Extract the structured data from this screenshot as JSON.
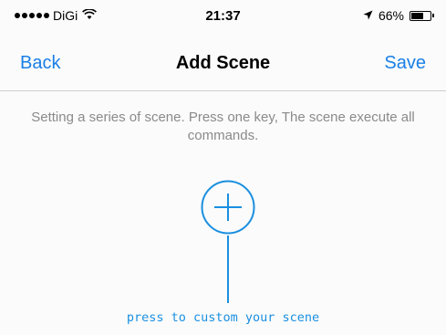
{
  "status_bar": {
    "carrier": "DiGi",
    "time": "21:37",
    "battery": "66%",
    "battery_level": 0.66,
    "icons": [
      "signal-dots-icon",
      "wifi-icon",
      "location-arrow-icon",
      "battery-icon"
    ]
  },
  "nav": {
    "back_label": "Back",
    "title": "Add Scene",
    "save_label": "Save"
  },
  "main": {
    "description": "Setting a series of scene. Press one key, The scene execute all commands.",
    "add_icon": "plus-circle-icon",
    "hint": "press to custom your scene"
  },
  "colors": {
    "accent": "#1a7fe6",
    "hint_blue": "#1a8fe0",
    "description_gray": "#8a8a8a",
    "background": "#fbfbfb"
  }
}
